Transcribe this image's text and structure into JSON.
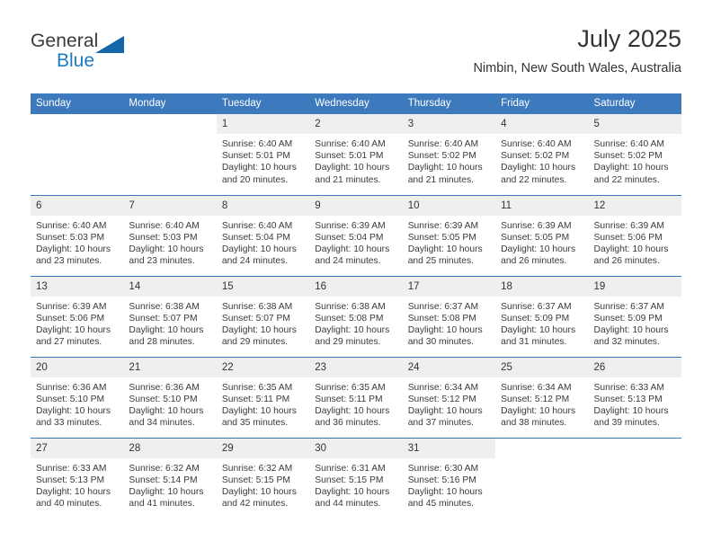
{
  "brand": {
    "word1": "General",
    "word2": "Blue",
    "accent_color": "#1a7bc4",
    "triangle_color": "#1565a8"
  },
  "header": {
    "title": "July 2025",
    "location": "Nimbin, New South Wales, Australia"
  },
  "calendar": {
    "header_bg": "#3c79bd",
    "daynum_bg": "#efefef",
    "weekdays": [
      "Sunday",
      "Monday",
      "Tuesday",
      "Wednesday",
      "Thursday",
      "Friday",
      "Saturday"
    ],
    "weeks": [
      [
        {
          "day": "",
          "blank": true,
          "lines": []
        },
        {
          "day": "",
          "blank": true,
          "lines": []
        },
        {
          "day": "1",
          "lines": [
            "Sunrise: 6:40 AM",
            "Sunset: 5:01 PM",
            "Daylight: 10 hours",
            "and 20 minutes."
          ]
        },
        {
          "day": "2",
          "lines": [
            "Sunrise: 6:40 AM",
            "Sunset: 5:01 PM",
            "Daylight: 10 hours",
            "and 21 minutes."
          ]
        },
        {
          "day": "3",
          "lines": [
            "Sunrise: 6:40 AM",
            "Sunset: 5:02 PM",
            "Daylight: 10 hours",
            "and 21 minutes."
          ]
        },
        {
          "day": "4",
          "lines": [
            "Sunrise: 6:40 AM",
            "Sunset: 5:02 PM",
            "Daylight: 10 hours",
            "and 22 minutes."
          ]
        },
        {
          "day": "5",
          "lines": [
            "Sunrise: 6:40 AM",
            "Sunset: 5:02 PM",
            "Daylight: 10 hours",
            "and 22 minutes."
          ]
        }
      ],
      [
        {
          "day": "6",
          "lines": [
            "Sunrise: 6:40 AM",
            "Sunset: 5:03 PM",
            "Daylight: 10 hours",
            "and 23 minutes."
          ]
        },
        {
          "day": "7",
          "lines": [
            "Sunrise: 6:40 AM",
            "Sunset: 5:03 PM",
            "Daylight: 10 hours",
            "and 23 minutes."
          ]
        },
        {
          "day": "8",
          "lines": [
            "Sunrise: 6:40 AM",
            "Sunset: 5:04 PM",
            "Daylight: 10 hours",
            "and 24 minutes."
          ]
        },
        {
          "day": "9",
          "lines": [
            "Sunrise: 6:39 AM",
            "Sunset: 5:04 PM",
            "Daylight: 10 hours",
            "and 24 minutes."
          ]
        },
        {
          "day": "10",
          "lines": [
            "Sunrise: 6:39 AM",
            "Sunset: 5:05 PM",
            "Daylight: 10 hours",
            "and 25 minutes."
          ]
        },
        {
          "day": "11",
          "lines": [
            "Sunrise: 6:39 AM",
            "Sunset: 5:05 PM",
            "Daylight: 10 hours",
            "and 26 minutes."
          ]
        },
        {
          "day": "12",
          "lines": [
            "Sunrise: 6:39 AM",
            "Sunset: 5:06 PM",
            "Daylight: 10 hours",
            "and 26 minutes."
          ]
        }
      ],
      [
        {
          "day": "13",
          "lines": [
            "Sunrise: 6:39 AM",
            "Sunset: 5:06 PM",
            "Daylight: 10 hours",
            "and 27 minutes."
          ]
        },
        {
          "day": "14",
          "lines": [
            "Sunrise: 6:38 AM",
            "Sunset: 5:07 PM",
            "Daylight: 10 hours",
            "and 28 minutes."
          ]
        },
        {
          "day": "15",
          "lines": [
            "Sunrise: 6:38 AM",
            "Sunset: 5:07 PM",
            "Daylight: 10 hours",
            "and 29 minutes."
          ]
        },
        {
          "day": "16",
          "lines": [
            "Sunrise: 6:38 AM",
            "Sunset: 5:08 PM",
            "Daylight: 10 hours",
            "and 29 minutes."
          ]
        },
        {
          "day": "17",
          "lines": [
            "Sunrise: 6:37 AM",
            "Sunset: 5:08 PM",
            "Daylight: 10 hours",
            "and 30 minutes."
          ]
        },
        {
          "day": "18",
          "lines": [
            "Sunrise: 6:37 AM",
            "Sunset: 5:09 PM",
            "Daylight: 10 hours",
            "and 31 minutes."
          ]
        },
        {
          "day": "19",
          "lines": [
            "Sunrise: 6:37 AM",
            "Sunset: 5:09 PM",
            "Daylight: 10 hours",
            "and 32 minutes."
          ]
        }
      ],
      [
        {
          "day": "20",
          "lines": [
            "Sunrise: 6:36 AM",
            "Sunset: 5:10 PM",
            "Daylight: 10 hours",
            "and 33 minutes."
          ]
        },
        {
          "day": "21",
          "lines": [
            "Sunrise: 6:36 AM",
            "Sunset: 5:10 PM",
            "Daylight: 10 hours",
            "and 34 minutes."
          ]
        },
        {
          "day": "22",
          "lines": [
            "Sunrise: 6:35 AM",
            "Sunset: 5:11 PM",
            "Daylight: 10 hours",
            "and 35 minutes."
          ]
        },
        {
          "day": "23",
          "lines": [
            "Sunrise: 6:35 AM",
            "Sunset: 5:11 PM",
            "Daylight: 10 hours",
            "and 36 minutes."
          ]
        },
        {
          "day": "24",
          "lines": [
            "Sunrise: 6:34 AM",
            "Sunset: 5:12 PM",
            "Daylight: 10 hours",
            "and 37 minutes."
          ]
        },
        {
          "day": "25",
          "lines": [
            "Sunrise: 6:34 AM",
            "Sunset: 5:12 PM",
            "Daylight: 10 hours",
            "and 38 minutes."
          ]
        },
        {
          "day": "26",
          "lines": [
            "Sunrise: 6:33 AM",
            "Sunset: 5:13 PM",
            "Daylight: 10 hours",
            "and 39 minutes."
          ]
        }
      ],
      [
        {
          "day": "27",
          "lines": [
            "Sunrise: 6:33 AM",
            "Sunset: 5:13 PM",
            "Daylight: 10 hours",
            "and 40 minutes."
          ]
        },
        {
          "day": "28",
          "lines": [
            "Sunrise: 6:32 AM",
            "Sunset: 5:14 PM",
            "Daylight: 10 hours",
            "and 41 minutes."
          ]
        },
        {
          "day": "29",
          "lines": [
            "Sunrise: 6:32 AM",
            "Sunset: 5:15 PM",
            "Daylight: 10 hours",
            "and 42 minutes."
          ]
        },
        {
          "day": "30",
          "lines": [
            "Sunrise: 6:31 AM",
            "Sunset: 5:15 PM",
            "Daylight: 10 hours",
            "and 44 minutes."
          ]
        },
        {
          "day": "31",
          "lines": [
            "Sunrise: 6:30 AM",
            "Sunset: 5:16 PM",
            "Daylight: 10 hours",
            "and 45 minutes."
          ]
        },
        {
          "day": "",
          "blank": true,
          "lines": []
        },
        {
          "day": "",
          "blank": true,
          "lines": []
        }
      ]
    ]
  }
}
